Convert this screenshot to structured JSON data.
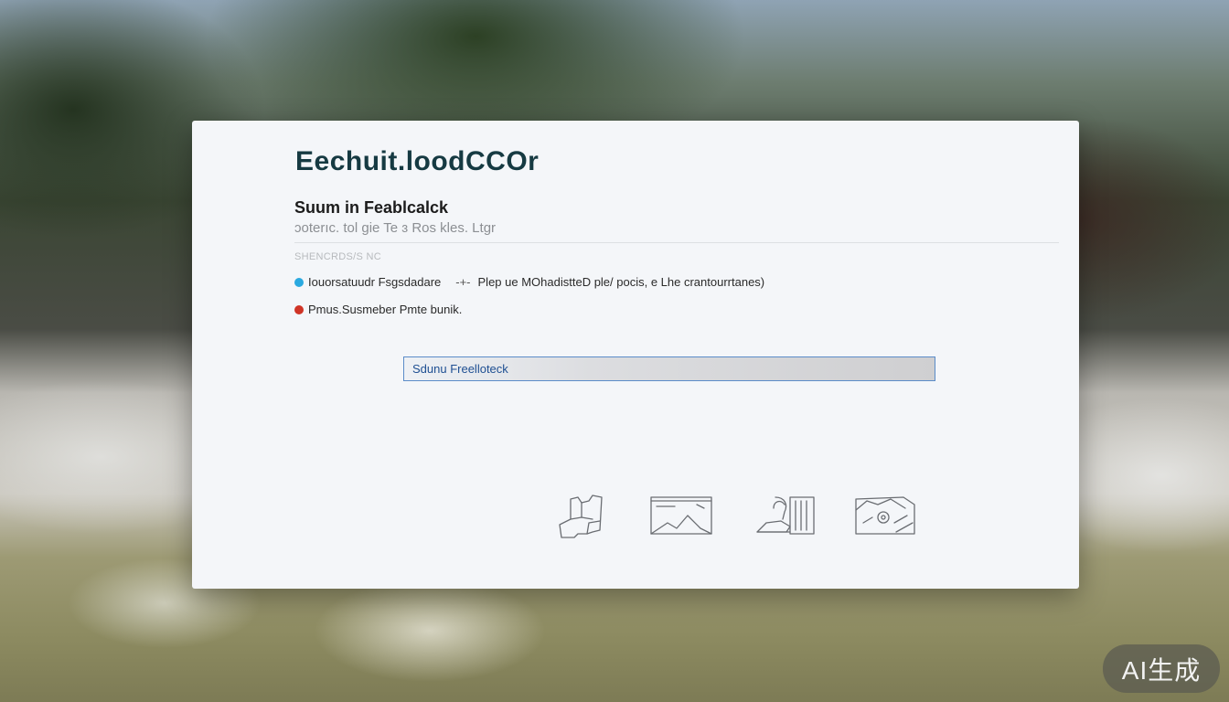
{
  "dialog": {
    "app_title": "Eechuit.loodCCOr",
    "heading": "Suum in Feablcalck",
    "subheading": "ɔoterıc. tol gie  Te ɜ Ros kles. Ltgr",
    "section_label": "SHENCRDS/S NC",
    "status_rows": [
      {
        "color": "#2aa9e0",
        "label": "Iouorsatuudr Fsgsdadare",
        "separator": "-+-",
        "detail": "Plep ue MOhadistteD  ple/ pocis,  e  Lhe crantourrtanes)"
      },
      {
        "color": "#cf3426",
        "label": "Pmus.Susmeber  Pmte bunik."
      }
    ],
    "submit_label": "Sdunu Freelloteck",
    "icons": [
      "hand-sketch-icon",
      "landscape-image-icon",
      "device-stand-icon",
      "photo-card-icon"
    ]
  },
  "watermark": "AI生成"
}
